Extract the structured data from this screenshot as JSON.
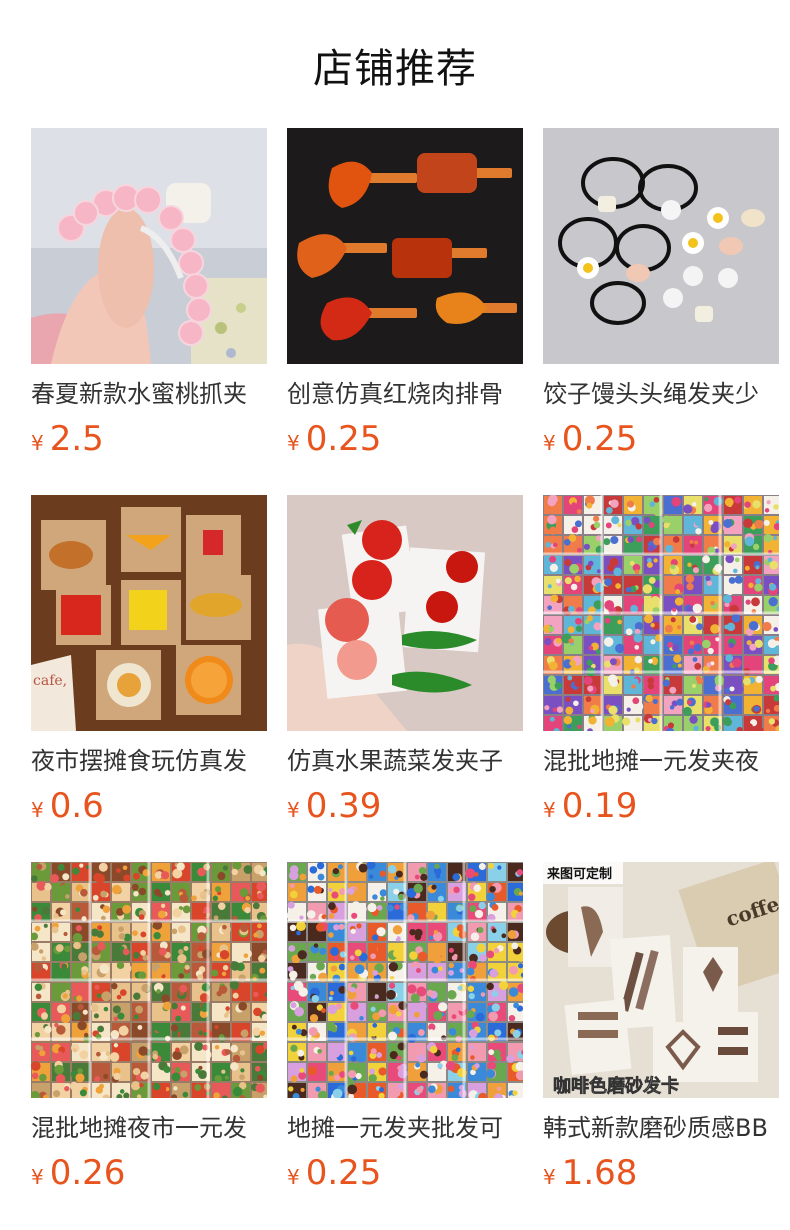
{
  "page": {
    "title": "店铺推荐"
  },
  "colors": {
    "accent": "#e8541e",
    "text": "#333333"
  },
  "products": [
    {
      "name": "春夏新款水蜜桃抓夹",
      "currency": "¥",
      "price": "2.5",
      "image": "peach-claw-clip-photo"
    },
    {
      "name": "创意仿真红烧肉排骨",
      "currency": "¥",
      "price": "0.25",
      "image": "braised-pork-hairclip-photo"
    },
    {
      "name": "饺子馒头头绳发夹少",
      "currency": "¥",
      "price": "0.25",
      "image": "dumpling-hair-tie-photo"
    },
    {
      "name": "夜市摆摊食玩仿真发",
      "currency": "¥",
      "price": "0.6",
      "image": "food-toy-hairclip-photo"
    },
    {
      "name": "仿真水果蔬菜发夹子",
      "currency": "¥",
      "price": "0.39",
      "image": "fruit-vegetable-hairclip-photo"
    },
    {
      "name": "混批地摊一元发夹夜",
      "currency": "¥",
      "price": "0.19",
      "image": "mixed-hairclip-box-photo"
    },
    {
      "name": "混批地摊夜市一元发",
      "currency": "¥",
      "price": "0.26",
      "image": "mixed-food-clip-box-photo"
    },
    {
      "name": "地摊一元发夹批发可",
      "currency": "¥",
      "price": "0.25",
      "image": "colorful-clip-box-photo"
    },
    {
      "name": "韩式新款磨砂质感BB",
      "currency": "¥",
      "price": "1.68",
      "image": "frosted-bb-clip-photo"
    }
  ],
  "image_text": {
    "p9_badge": "来图可定制",
    "p9_caption": "咖啡色磨砂发卡",
    "p9_book": "coffe",
    "p4_sign": "cafe,"
  }
}
